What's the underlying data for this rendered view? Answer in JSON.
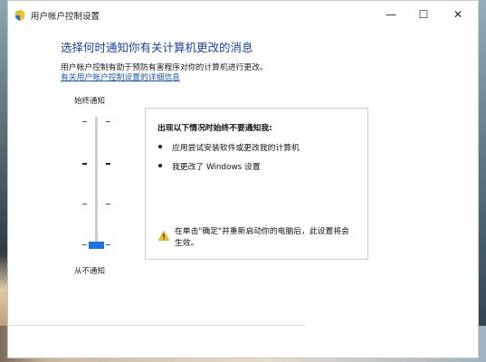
{
  "window": {
    "title": "用户帐户控制设置",
    "controls": [
      "minimize",
      "maximize",
      "close"
    ],
    "minimize_glyph": "—",
    "maximize_glyph": "☐",
    "close_glyph": "✕"
  },
  "main": {
    "heading": "选择何时通知你有关计算机更改的消息",
    "description": "用户帐户控制有助于预防有害程序对你的计算机进行更改。",
    "link": "有关用户帐户控制设置的详细信息"
  },
  "slider": {
    "top_label": "始终通知",
    "bottom_label": "从不通知",
    "levels": 4,
    "selected_level": 1
  },
  "info": {
    "title": "出现以下情况时始终不要通知我:",
    "items": [
      "应用尝试安装软件或更改我的计算机",
      "我更改了 Windows 设置"
    ],
    "warning": "在单击\"确定\"并重新启动你的电脑后，此设置将会生效。"
  },
  "colors": {
    "heading": "#1f3fa6",
    "link": "#1b57b8",
    "thumb": "#1a73e8",
    "warning": "#f2c318"
  },
  "icons": {
    "app": "shield-icon",
    "warning": "warning-icon"
  }
}
